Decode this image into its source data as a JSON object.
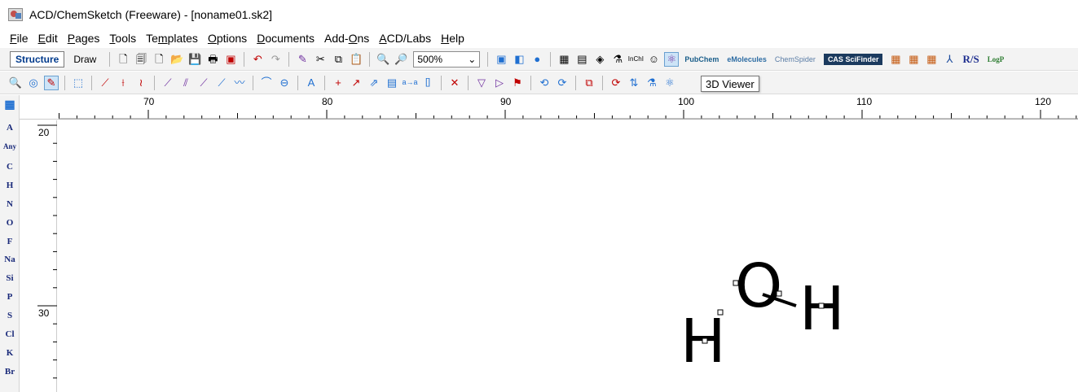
{
  "window": {
    "title": "ACD/ChemSketch (Freeware) - [noname01.sk2]"
  },
  "menu": [
    {
      "pre": "",
      "u": "F",
      "post": "ile"
    },
    {
      "pre": "",
      "u": "E",
      "post": "dit"
    },
    {
      "pre": "",
      "u": "P",
      "post": "ages"
    },
    {
      "pre": "",
      "u": "T",
      "post": "ools"
    },
    {
      "pre": "Te",
      "u": "m",
      "post": "plates"
    },
    {
      "pre": "",
      "u": "O",
      "post": "ptions"
    },
    {
      "pre": "",
      "u": "D",
      "post": "ocuments"
    },
    {
      "pre": "Add-",
      "u": "O",
      "post": "ns"
    },
    {
      "pre": "",
      "u": "A",
      "post": "CD/Labs"
    },
    {
      "pre": "",
      "u": "H",
      "post": "elp"
    }
  ],
  "modes": {
    "structure": "Structure",
    "draw": "Draw"
  },
  "zoom": {
    "value": "500%"
  },
  "brands": {
    "pubchem": "PubChem",
    "emolecules": "eMolecules",
    "chemspider": "ChemSpider",
    "cas": "CAS SciFinder",
    "rs": "R/S",
    "logp": "LogP"
  },
  "tooltip": {
    "text": "3D Viewer"
  },
  "ruler": {
    "unit": "mm",
    "top_ticks": [
      "70",
      "80",
      "90",
      "100",
      "110",
      "120"
    ],
    "left_ticks": [
      "20",
      "30"
    ]
  },
  "palette": [
    "A",
    "Any",
    "C",
    "H",
    "N",
    "O",
    "F",
    "Na",
    "Si",
    "P",
    "S",
    "Cl",
    "K",
    "Br"
  ],
  "molecule": {
    "atoms": [
      {
        "id": "O",
        "label": "O"
      },
      {
        "id": "H1",
        "label": "H"
      },
      {
        "id": "H2",
        "label": "H"
      }
    ]
  }
}
